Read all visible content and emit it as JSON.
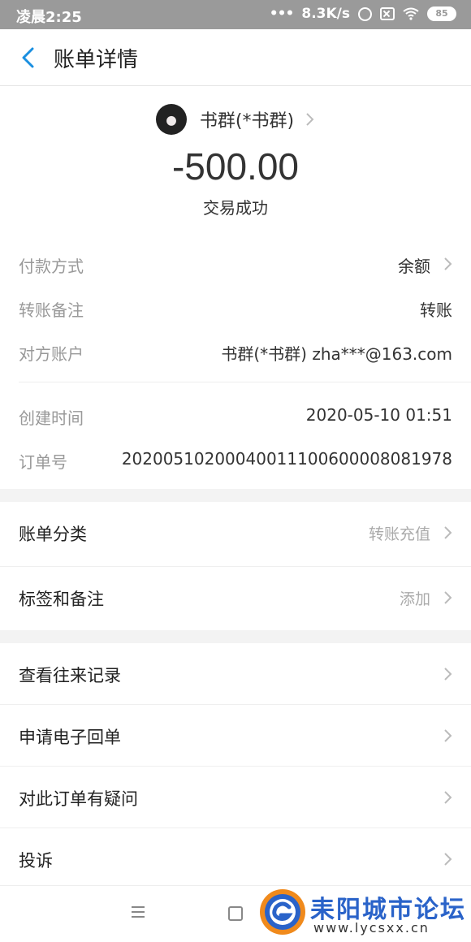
{
  "status_bar": {
    "time": "凌晨2:25",
    "speed": "8.3K/s",
    "battery": "85"
  },
  "header": {
    "title": "账单详情",
    "back_icon": "chevron-left-icon"
  },
  "summary": {
    "party_name": "书群(*书群)",
    "amount": "-500.00",
    "status": "交易成功"
  },
  "details": [
    {
      "label": "付款方式",
      "value": "余额",
      "has_chevron": true
    },
    {
      "label": "转账备注",
      "value": "转账",
      "has_chevron": false
    },
    {
      "label": "对方账户",
      "value": "书群(*书群) zha***@163.com",
      "has_chevron": false
    },
    {
      "label": "创建时间",
      "value": "2020-05-10 01:51",
      "has_chevron": false
    },
    {
      "label": "订单号",
      "value": "20200510200040011100600008081978",
      "has_chevron": false
    }
  ],
  "category_section": [
    {
      "label": "账单分类",
      "value": "转账充值"
    },
    {
      "label": "标签和备注",
      "value": "添加"
    }
  ],
  "actions": [
    {
      "label": "查看往来记录"
    },
    {
      "label": "申请电子回单"
    },
    {
      "label": "对此订单有疑问"
    },
    {
      "label": "投诉"
    }
  ],
  "watermark": {
    "title": "耒阳城市论坛",
    "url": "www.lycsxx.cn"
  },
  "colors": {
    "accent": "#1a8fe0",
    "status_bar": "#9a9a9a",
    "watermark_blue": "#2a63c9",
    "watermark_orange": "#f08a1c"
  }
}
